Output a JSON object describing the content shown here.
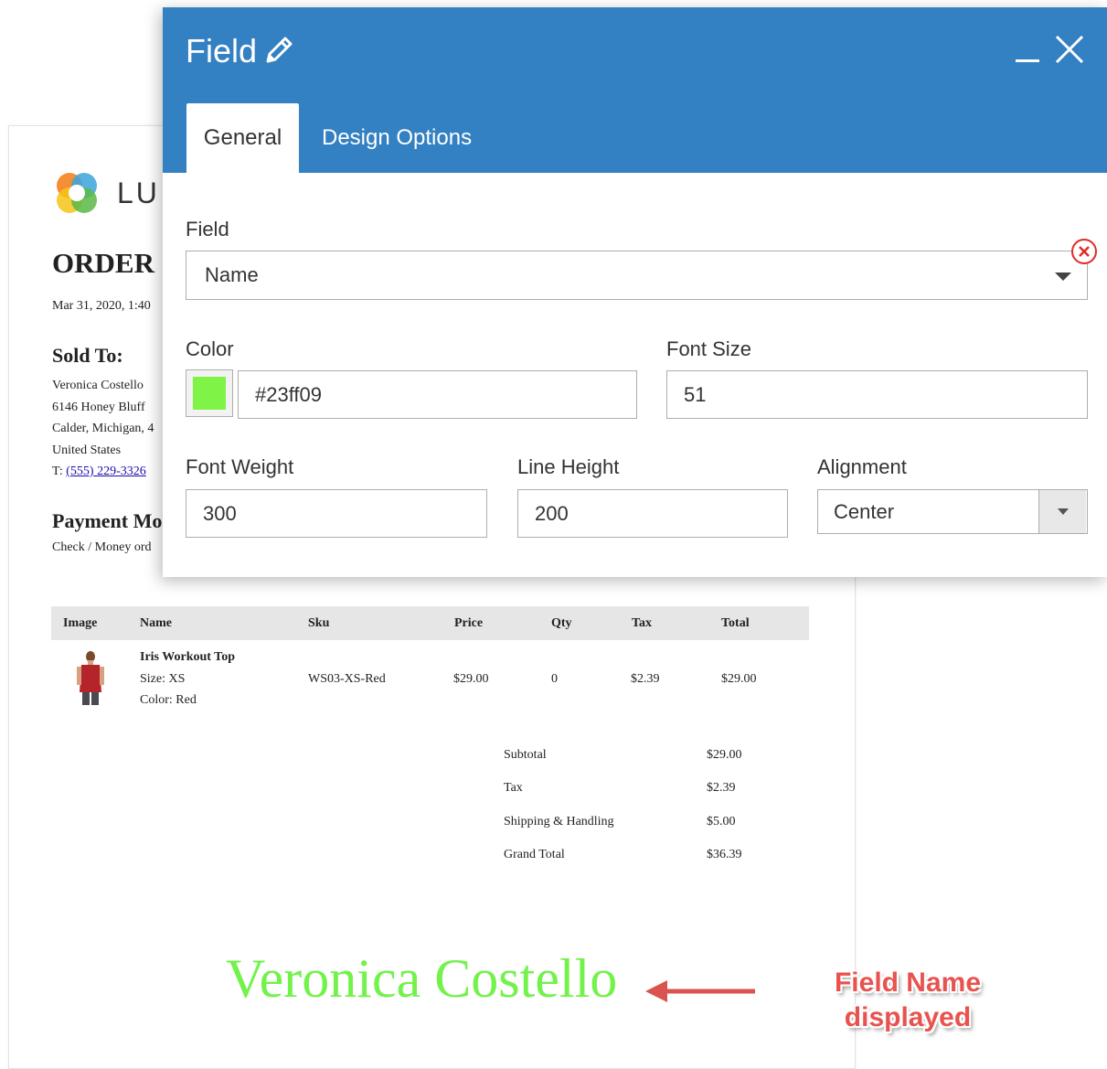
{
  "document": {
    "logo_text": "LU",
    "order_title": "ORDER",
    "order_date": "Mar 31, 2020, 1:40",
    "sold_to": {
      "heading": "Sold To:",
      "name": "Veronica Costello",
      "street": "6146 Honey Bluff",
      "city": "Calder, Michigan, 4",
      "country": "United States",
      "phone_prefix": "T: ",
      "phone": "(555) 229-3326"
    },
    "payment": {
      "heading": "Payment Mo",
      "method": "Check / Money ord"
    },
    "items_table": {
      "headers": [
        "Image",
        "Name",
        "Sku",
        "Price",
        "Qty",
        "Tax",
        "Total"
      ],
      "rows": [
        {
          "name": "Iris Workout Top",
          "size": "Size: XS",
          "color": "Color: Red",
          "sku": "WS03-XS-Red",
          "price": "$29.00",
          "qty": "0",
          "tax": "$2.39",
          "total": "$29.00"
        }
      ]
    },
    "totals": [
      {
        "label": "Subtotal",
        "value": "$29.00"
      },
      {
        "label": "Tax",
        "value": "$2.39"
      },
      {
        "label": "Shipping & Handling",
        "value": "$5.00"
      },
      {
        "label": "Grand Total",
        "value": "$36.39"
      }
    ],
    "display_field_value": "Veronica Costello",
    "display_field_color": "#72f24a"
  },
  "annotation": {
    "line1": "Field Name",
    "line2": "displayed",
    "color": "#e8534f"
  },
  "modal": {
    "title": "Field",
    "header_color": "#3380c2",
    "tabs": [
      {
        "label": "General",
        "active": true
      },
      {
        "label": "Design Options",
        "active": false
      }
    ],
    "field": {
      "label": "Field",
      "value": "Name"
    },
    "color": {
      "label": "Color",
      "value": "#23ff09",
      "swatch": "#7ff346"
    },
    "font_size": {
      "label": "Font Size",
      "value": "51"
    },
    "font_weight": {
      "label": "Font Weight",
      "value": "300"
    },
    "line_height": {
      "label": "Line Height",
      "value": "200"
    },
    "alignment": {
      "label": "Alignment",
      "value": "Center"
    }
  }
}
